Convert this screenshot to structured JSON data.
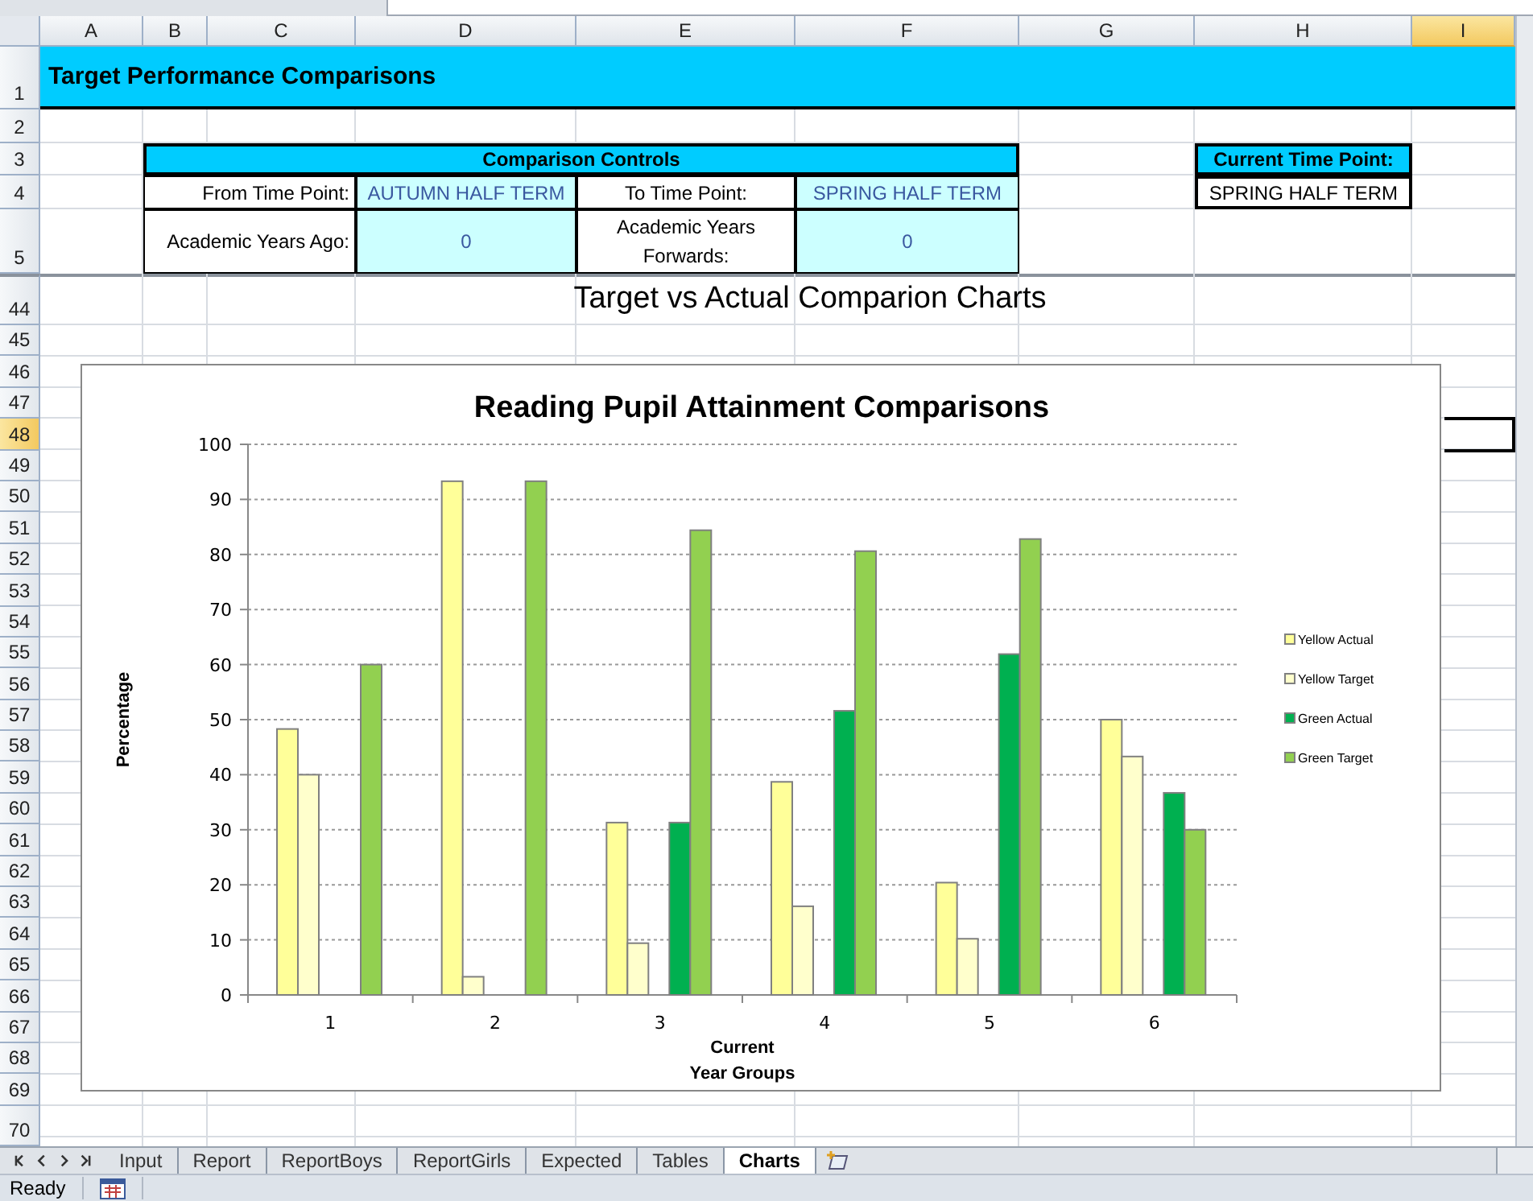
{
  "column_headers": [
    {
      "label": "A",
      "selected": false
    },
    {
      "label": "B",
      "selected": false
    },
    {
      "label": "C",
      "selected": false
    },
    {
      "label": "D",
      "selected": false
    },
    {
      "label": "E",
      "selected": false
    },
    {
      "label": "F",
      "selected": false
    },
    {
      "label": "G",
      "selected": false
    },
    {
      "label": "H",
      "selected": false
    },
    {
      "label": "I",
      "selected": true
    }
  ],
  "row_headers": [
    {
      "label": "1",
      "selected": false
    },
    {
      "label": "2",
      "selected": false
    },
    {
      "label": "3",
      "selected": false
    },
    {
      "label": "4",
      "selected": false
    },
    {
      "label": "5",
      "selected": false
    },
    {
      "label": "44",
      "selected": false
    },
    {
      "label": "45",
      "selected": false
    },
    {
      "label": "46",
      "selected": false
    },
    {
      "label": "47",
      "selected": false
    },
    {
      "label": "48",
      "selected": true
    },
    {
      "label": "49",
      "selected": false
    },
    {
      "label": "50",
      "selected": false
    },
    {
      "label": "51",
      "selected": false
    },
    {
      "label": "52",
      "selected": false
    },
    {
      "label": "53",
      "selected": false
    },
    {
      "label": "54",
      "selected": false
    },
    {
      "label": "55",
      "selected": false
    },
    {
      "label": "56",
      "selected": false
    },
    {
      "label": "57",
      "selected": false
    },
    {
      "label": "58",
      "selected": false
    },
    {
      "label": "59",
      "selected": false
    },
    {
      "label": "60",
      "selected": false
    },
    {
      "label": "61",
      "selected": false
    },
    {
      "label": "62",
      "selected": false
    },
    {
      "label": "63",
      "selected": false
    },
    {
      "label": "64",
      "selected": false
    },
    {
      "label": "65",
      "selected": false
    },
    {
      "label": "66",
      "selected": false
    },
    {
      "label": "67",
      "selected": false
    },
    {
      "label": "68",
      "selected": false
    },
    {
      "label": "69",
      "selected": false
    },
    {
      "label": "70",
      "selected": false
    }
  ],
  "title_banner": "Target Performance Comparisons",
  "comparison_controls": {
    "title": "Comparison Controls",
    "from_label": "From Time Point:",
    "from_value": "AUTUMN HALF TERM",
    "to_label": "To Time Point:",
    "to_value": "SPRING HALF TERM",
    "years_ago_label": "Academic Years Ago:",
    "years_ago_value": "0",
    "years_forward_label": "Academic Years Forwards:",
    "years_forward_value": "0"
  },
  "current_time_point": {
    "title": "Current Time Point:",
    "value": "SPRING HALF TERM"
  },
  "charts_heading": "Target vs Actual Comparion Charts",
  "chart": {
    "chart_data": {
      "type": "bar",
      "title": "Reading Pupil Attainment Comparisons",
      "xlabel": "Current Year Groups",
      "ylabel": "Percentage",
      "categories": [
        "1",
        "2",
        "3",
        "4",
        "5",
        "6"
      ],
      "series": [
        {
          "name": "Yellow Actual",
          "color": "#ffff99",
          "values": [
            48.3,
            93.3,
            31.3,
            38.7,
            20.4,
            50
          ]
        },
        {
          "name": "Yellow Target",
          "color": "#ffffcc",
          "values": [
            40,
            3.3,
            9.4,
            16.1,
            10.2,
            43.3
          ]
        },
        {
          "name": "Green Actual",
          "color": "#00b050",
          "values": [
            null,
            null,
            31.3,
            51.6,
            61.9,
            36.7
          ]
        },
        {
          "name": "Green Target",
          "color": "#92d050",
          "values": [
            60,
            93.3,
            84.4,
            80.6,
            82.8,
            30
          ]
        }
      ],
      "grid": true,
      "legend": true,
      "ylim": [
        0,
        100
      ],
      "yticks": [
        0,
        10,
        20,
        30,
        40,
        50,
        60,
        70,
        80,
        90,
        100
      ]
    }
  },
  "sheet_tabs": [
    {
      "label": "Input",
      "selected": false
    },
    {
      "label": "Report",
      "selected": false
    },
    {
      "label": "ReportBoys",
      "selected": false
    },
    {
      "label": "ReportGirls",
      "selected": false
    },
    {
      "label": "Expected",
      "selected": false
    },
    {
      "label": "Tables",
      "selected": false
    },
    {
      "label": "Charts",
      "selected": true
    }
  ],
  "status_bar": {
    "text": "Ready"
  }
}
